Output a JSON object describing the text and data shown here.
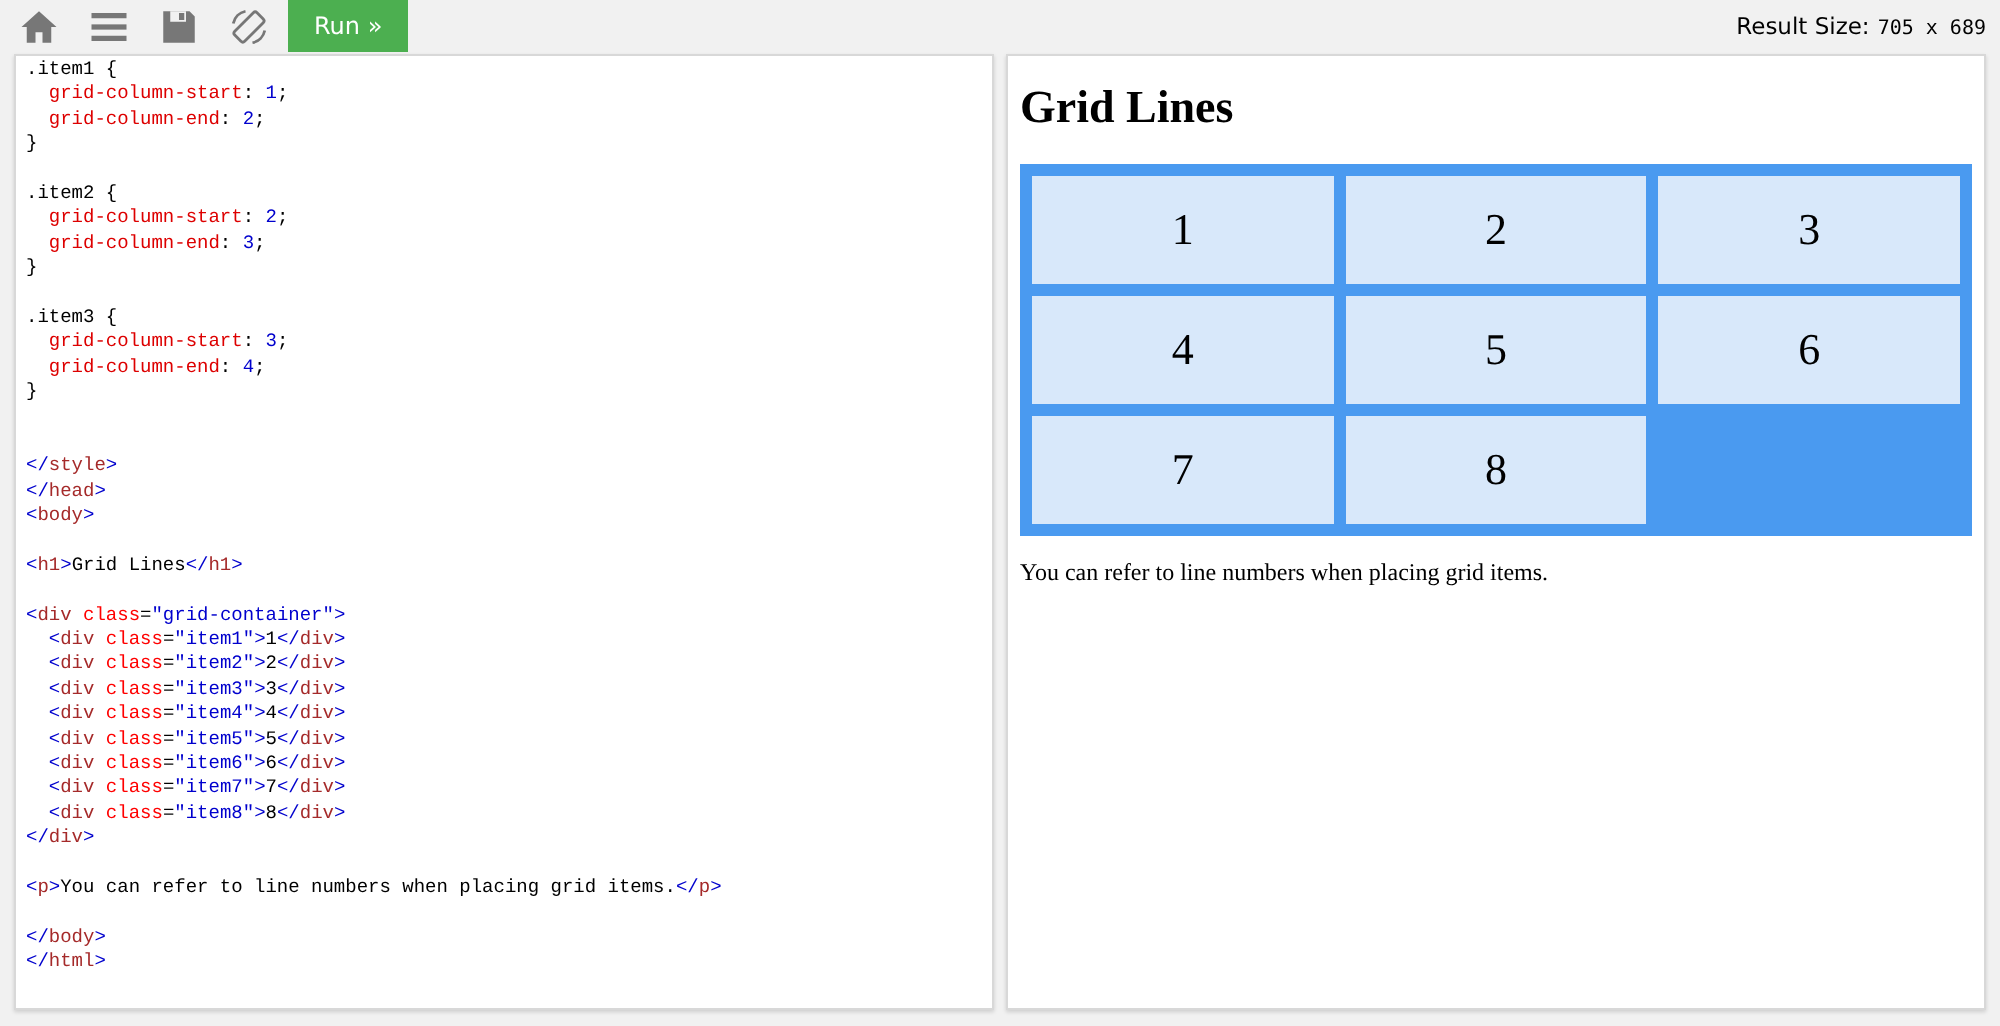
{
  "toolbar": {
    "buttons": [
      {
        "kind": "home"
      },
      {
        "kind": "menu"
      },
      {
        "kind": "save"
      },
      {
        "kind": "rotate"
      }
    ],
    "run_button": "Run »",
    "result_size": {
      "label": "Result Size:",
      "value": "705 x 689"
    }
  },
  "code_editor": {
    "lines": [
      {
        "kind": "code",
        "segments": [
          {
            "kind": "text",
            "text": ".item1 {"
          }
        ]
      },
      {
        "kind": "code",
        "segments": [
          {
            "kind": "prop",
            "text": "  grid-column-start"
          },
          {
            "kind": "text",
            "text": ": "
          },
          {
            "kind": "num",
            "text": "1"
          },
          {
            "kind": "text",
            "text": ";"
          }
        ]
      },
      {
        "kind": "code",
        "segments": [
          {
            "kind": "prop",
            "text": "  grid-column-end"
          },
          {
            "kind": "text",
            "text": ": "
          },
          {
            "kind": "num",
            "text": "2"
          },
          {
            "kind": "text",
            "text": ";"
          }
        ]
      },
      {
        "kind": "code",
        "segments": [
          {
            "kind": "text",
            "text": "}"
          }
        ]
      },
      {
        "kind": "blank"
      },
      {
        "kind": "code",
        "segments": [
          {
            "kind": "text",
            "text": ".item2 {"
          }
        ]
      },
      {
        "kind": "code",
        "segments": [
          {
            "kind": "prop",
            "text": "  grid-column-start"
          },
          {
            "kind": "text",
            "text": ": "
          },
          {
            "kind": "num",
            "text": "2"
          },
          {
            "kind": "text",
            "text": ";"
          }
        ]
      },
      {
        "kind": "code",
        "segments": [
          {
            "kind": "prop",
            "text": "  grid-column-end"
          },
          {
            "kind": "text",
            "text": ": "
          },
          {
            "kind": "num",
            "text": "3"
          },
          {
            "kind": "text",
            "text": ";"
          }
        ]
      },
      {
        "kind": "code",
        "segments": [
          {
            "kind": "text",
            "text": "}"
          }
        ]
      },
      {
        "kind": "blank"
      },
      {
        "kind": "code",
        "segments": [
          {
            "kind": "text",
            "text": ".item3 {"
          }
        ]
      },
      {
        "kind": "code",
        "segments": [
          {
            "kind": "prop",
            "text": "  grid-column-start"
          },
          {
            "kind": "text",
            "text": ": "
          },
          {
            "kind": "num",
            "text": "3"
          },
          {
            "kind": "text",
            "text": ";"
          }
        ]
      },
      {
        "kind": "code",
        "segments": [
          {
            "kind": "prop",
            "text": "  grid-column-end"
          },
          {
            "kind": "text",
            "text": ": "
          },
          {
            "kind": "num",
            "text": "4"
          },
          {
            "kind": "text",
            "text": ";"
          }
        ]
      },
      {
        "kind": "code",
        "segments": [
          {
            "kind": "text",
            "text": "}"
          }
        ]
      },
      {
        "kind": "blank"
      },
      {
        "kind": "blank"
      },
      {
        "kind": "code",
        "segments": [
          {
            "kind": "bracket",
            "text": "</"
          },
          {
            "kind": "tag",
            "text": "style"
          },
          {
            "kind": "bracket",
            "text": ">"
          }
        ]
      },
      {
        "kind": "code",
        "segments": [
          {
            "kind": "bracket",
            "text": "</"
          },
          {
            "kind": "tag",
            "text": "head"
          },
          {
            "kind": "bracket",
            "text": ">"
          }
        ]
      },
      {
        "kind": "code",
        "segments": [
          {
            "kind": "bracket",
            "text": "<"
          },
          {
            "kind": "tag",
            "text": "body"
          },
          {
            "kind": "bracket",
            "text": ">"
          }
        ]
      },
      {
        "kind": "blank"
      },
      {
        "kind": "code",
        "segments": [
          {
            "kind": "bracket",
            "text": "<"
          },
          {
            "kind": "tag",
            "text": "h1"
          },
          {
            "kind": "bracket",
            "text": ">"
          },
          {
            "kind": "text",
            "text": "Grid Lines"
          },
          {
            "kind": "bracket",
            "text": "</"
          },
          {
            "kind": "tag",
            "text": "h1"
          },
          {
            "kind": "bracket",
            "text": ">"
          }
        ]
      },
      {
        "kind": "blank"
      },
      {
        "kind": "code",
        "segments": [
          {
            "kind": "bracket",
            "text": "<"
          },
          {
            "kind": "tag",
            "text": "div"
          },
          {
            "kind": "attr",
            "text": " class"
          },
          {
            "kind": "text",
            "text": "="
          },
          {
            "kind": "value",
            "text": "\"grid-container\""
          },
          {
            "kind": "bracket",
            "text": ">"
          }
        ]
      },
      {
        "kind": "code",
        "segments": [
          {
            "kind": "bracket",
            "text": "  <"
          },
          {
            "kind": "tag",
            "text": "div"
          },
          {
            "kind": "attr",
            "text": " class"
          },
          {
            "kind": "text",
            "text": "="
          },
          {
            "kind": "value",
            "text": "\"item1\""
          },
          {
            "kind": "bracket",
            "text": ">"
          },
          {
            "kind": "text",
            "text": "1"
          },
          {
            "kind": "bracket",
            "text": "</"
          },
          {
            "kind": "tag",
            "text": "div"
          },
          {
            "kind": "bracket",
            "text": ">"
          }
        ]
      },
      {
        "kind": "code",
        "segments": [
          {
            "kind": "bracket",
            "text": "  <"
          },
          {
            "kind": "tag",
            "text": "div"
          },
          {
            "kind": "attr",
            "text": " class"
          },
          {
            "kind": "text",
            "text": "="
          },
          {
            "kind": "value",
            "text": "\"item2\""
          },
          {
            "kind": "bracket",
            "text": ">"
          },
          {
            "kind": "text",
            "text": "2"
          },
          {
            "kind": "bracket",
            "text": "</"
          },
          {
            "kind": "tag",
            "text": "div"
          },
          {
            "kind": "bracket",
            "text": ">"
          }
        ]
      },
      {
        "kind": "code",
        "segments": [
          {
            "kind": "bracket",
            "text": "  <"
          },
          {
            "kind": "tag",
            "text": "div"
          },
          {
            "kind": "attr",
            "text": " class"
          },
          {
            "kind": "text",
            "text": "="
          },
          {
            "kind": "value",
            "text": "\"item3\""
          },
          {
            "kind": "bracket",
            "text": ">"
          },
          {
            "kind": "text",
            "text": "3"
          },
          {
            "kind": "bracket",
            "text": "</"
          },
          {
            "kind": "tag",
            "text": "div"
          },
          {
            "kind": "bracket",
            "text": ">"
          }
        ]
      },
      {
        "kind": "code",
        "segments": [
          {
            "kind": "bracket",
            "text": "  <"
          },
          {
            "kind": "tag",
            "text": "div"
          },
          {
            "kind": "attr",
            "text": " class"
          },
          {
            "kind": "text",
            "text": "="
          },
          {
            "kind": "value",
            "text": "\"item4\""
          },
          {
            "kind": "bracket",
            "text": ">"
          },
          {
            "kind": "text",
            "text": "4"
          },
          {
            "kind": "bracket",
            "text": "</"
          },
          {
            "kind": "tag",
            "text": "div"
          },
          {
            "kind": "bracket",
            "text": ">"
          }
        ]
      },
      {
        "kind": "code",
        "segments": [
          {
            "kind": "bracket",
            "text": "  <"
          },
          {
            "kind": "tag",
            "text": "div"
          },
          {
            "kind": "attr",
            "text": " class"
          },
          {
            "kind": "text",
            "text": "="
          },
          {
            "kind": "value",
            "text": "\"item5\""
          },
          {
            "kind": "bracket",
            "text": ">"
          },
          {
            "kind": "text",
            "text": "5"
          },
          {
            "kind": "bracket",
            "text": "</"
          },
          {
            "kind": "tag",
            "text": "div"
          },
          {
            "kind": "bracket",
            "text": ">"
          }
        ]
      },
      {
        "kind": "code",
        "segments": [
          {
            "kind": "bracket",
            "text": "  <"
          },
          {
            "kind": "tag",
            "text": "div"
          },
          {
            "kind": "attr",
            "text": " class"
          },
          {
            "kind": "text",
            "text": "="
          },
          {
            "kind": "value",
            "text": "\"item6\""
          },
          {
            "kind": "bracket",
            "text": ">"
          },
          {
            "kind": "text",
            "text": "6"
          },
          {
            "kind": "bracket",
            "text": "</"
          },
          {
            "kind": "tag",
            "text": "div"
          },
          {
            "kind": "bracket",
            "text": ">"
          }
        ]
      },
      {
        "kind": "code",
        "segments": [
          {
            "kind": "bracket",
            "text": "  <"
          },
          {
            "kind": "tag",
            "text": "div"
          },
          {
            "kind": "attr",
            "text": " class"
          },
          {
            "kind": "text",
            "text": "="
          },
          {
            "kind": "value",
            "text": "\"item7\""
          },
          {
            "kind": "bracket",
            "text": ">"
          },
          {
            "kind": "text",
            "text": "7"
          },
          {
            "kind": "bracket",
            "text": "</"
          },
          {
            "kind": "tag",
            "text": "div"
          },
          {
            "kind": "bracket",
            "text": ">"
          }
        ]
      },
      {
        "kind": "code",
        "segments": [
          {
            "kind": "bracket",
            "text": "  <"
          },
          {
            "kind": "tag",
            "text": "div"
          },
          {
            "kind": "attr",
            "text": " class"
          },
          {
            "kind": "text",
            "text": "="
          },
          {
            "kind": "value",
            "text": "\"item8\""
          },
          {
            "kind": "bracket",
            "text": ">"
          },
          {
            "kind": "text",
            "text": "8"
          },
          {
            "kind": "bracket",
            "text": "</"
          },
          {
            "kind": "tag",
            "text": "div"
          },
          {
            "kind": "bracket",
            "text": ">"
          }
        ]
      },
      {
        "kind": "code",
        "segments": [
          {
            "kind": "bracket",
            "text": "</"
          },
          {
            "kind": "tag",
            "text": "div"
          },
          {
            "kind": "bracket",
            "text": ">"
          }
        ]
      },
      {
        "kind": "blank"
      },
      {
        "kind": "code",
        "segments": [
          {
            "kind": "bracket",
            "text": "<"
          },
          {
            "kind": "tag",
            "text": "p"
          },
          {
            "kind": "bracket",
            "text": ">"
          },
          {
            "kind": "text",
            "text": "You can refer to line numbers when placing grid items."
          },
          {
            "kind": "bracket",
            "text": "</"
          },
          {
            "kind": "tag",
            "text": "p"
          },
          {
            "kind": "bracket",
            "text": ">"
          }
        ]
      },
      {
        "kind": "blank"
      },
      {
        "kind": "code",
        "segments": [
          {
            "kind": "bracket",
            "text": "</"
          },
          {
            "kind": "tag",
            "text": "body"
          },
          {
            "kind": "bracket",
            "text": ">"
          }
        ]
      },
      {
        "kind": "code",
        "segments": [
          {
            "kind": "bracket",
            "text": "</"
          },
          {
            "kind": "tag",
            "text": "html"
          },
          {
            "kind": "bracket",
            "text": ">"
          }
        ]
      }
    ]
  },
  "result": {
    "heading": "Grid Lines",
    "grid_items": [
      "1",
      "2",
      "3",
      "4",
      "5",
      "6",
      "7",
      "8"
    ],
    "paragraph": "You can refer to line numbers when placing grid items."
  }
}
